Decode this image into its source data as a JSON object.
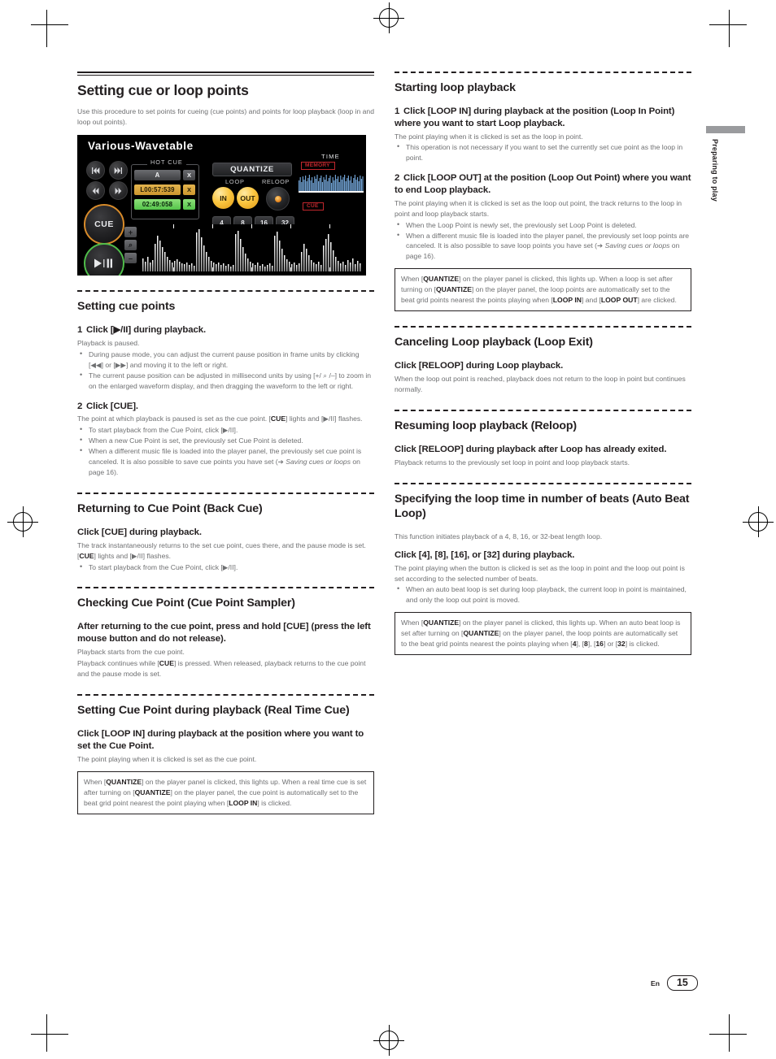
{
  "page": {
    "footer_lang": "En",
    "footer_page": "15",
    "side_tab_label": "Preparing to play"
  },
  "left_column": {
    "title": "Setting cue or loop points",
    "intro": "Use this procedure to set points for cueing (cue points) and points for loop playback (loop in and loop out points).",
    "player_panel": {
      "track_title": "Various-Wavetable",
      "hot_cue_label": "HOT CUE",
      "hot_cue_rows": [
        {
          "value": "A",
          "close": "X",
          "color": "grey"
        },
        {
          "value": "L00:57:539",
          "close": "X",
          "color": "orange"
        },
        {
          "value": "02:49:058",
          "close": "X",
          "color": "green"
        }
      ],
      "quantize_label": "QUANTIZE",
      "loop_label": "LOOP",
      "reloop_label": "RELOOP",
      "loop_in_label": "IN",
      "loop_out_label": "OUT",
      "beat_buttons": [
        "4",
        "8",
        "16",
        "32"
      ],
      "time_label": "TIME",
      "memory_tag": "MEMORY",
      "cue_tag": "CUE",
      "cue_button_label": "CUE",
      "play_pause_label": "▶/II",
      "transport_buttons": [
        "⏮",
        "⏭",
        "◀◀",
        "▶▶"
      ],
      "zoom_controls": [
        "+",
        "⌕",
        "–"
      ]
    },
    "sections": [
      {
        "heading": "Setting cue points",
        "steps": [
          {
            "num": "1",
            "title": "Click [▶/II] during playback.",
            "body": "Playback is paused.",
            "bullets": [
              "During pause mode, you can adjust the current pause position in frame units by clicking [◀◀] or [▶▶] and moving it to the left or right.",
              "The current pause position can be adjusted in millisecond units by using [+/ ⌕ /–] to zoom in on the enlarged waveform display, and then dragging the waveform to the left or right."
            ]
          },
          {
            "num": "2",
            "title": "Click [CUE].",
            "body": "The point at which playback is paused is set as the cue point. [CUE] lights and [▶/II] flashes.",
            "bullets": [
              "To start playback from the Cue Point, click [▶/II].",
              "When a new Cue Point is set, the previously set Cue Point is deleted.",
              "When a different music file is loaded into the player panel, the previously set cue point is canceled. It is also possible to save cue points you have set (➔ Saving cues or loops on page 16)."
            ]
          }
        ]
      },
      {
        "heading": "Returning to Cue Point (Back Cue)",
        "bold_lead": "Click [CUE] during playback.",
        "body": "The track instantaneously returns to the set cue point, cues there, and the pause mode is set. [CUE] lights and [▶/II] flashes.",
        "bullets": [
          "To start playback from the Cue Point, click [▶/II]."
        ]
      },
      {
        "heading": "Checking Cue Point (Cue Point Sampler)",
        "bold_lead": "After returning to the cue point, press and hold [CUE] (press the left mouse button and do not release).",
        "body": "Playback starts from the cue point.",
        "body2": "Playback continues while [CUE] is pressed. When released, playback returns to the cue point and the pause mode is set."
      },
      {
        "heading": "Setting Cue Point during playback (Real Time Cue)",
        "bold_lead": "Click [LOOP IN] during playback at the position where you want to set the Cue Point.",
        "body": "The point playing when it is clicked is set as the cue point.",
        "note": "When [QUANTIZE] on the player panel is clicked, this lights up. When a real time cue is set after turning on [QUANTIZE] on the player panel, the cue point is automatically set to the beat grid point nearest the point playing when [LOOP IN] is clicked."
      }
    ]
  },
  "right_column": {
    "sections": [
      {
        "heading": "Starting loop playback",
        "steps": [
          {
            "num": "1",
            "title": "Click [LOOP IN] during playback at the position (Loop In Point) where you want to start Loop playback.",
            "body": "The point playing when it is clicked is set as the loop in point.",
            "bullets": [
              "This operation is not necessary if you want to set the currently set cue point as the loop in point."
            ]
          },
          {
            "num": "2",
            "title": "Click [LOOP OUT] at the position (Loop Out Point) where you want to end Loop playback.",
            "body": "The point playing when it is clicked is set as the loop out point, the track returns to the loop in point and loop playback starts.",
            "bullets": [
              "When the Loop Point is newly set, the previously set Loop Point is deleted.",
              "When a different music file is loaded into the player panel, the previously set loop points are canceled. It is also possible to save loop points you have set (➔ Saving cues or loops on page 16)."
            ],
            "note": "When [QUANTIZE] on the player panel is clicked, this lights up. When a loop is set after turning on [QUANTIZE] on the player panel, the loop points are automatically set to the beat grid points nearest the points playing when [LOOP IN] and [LOOP OUT] are clicked."
          }
        ]
      },
      {
        "heading": "Canceling Loop playback (Loop Exit)",
        "bold_lead": "Click [RELOOP] during Loop playback.",
        "body": "When the loop out point is reached, playback does not return to the loop in point but continues normally."
      },
      {
        "heading": "Resuming loop playback (Reloop)",
        "bold_lead": "Click [RELOOP] during playback after Loop has already exited.",
        "body": "Playback returns to the previously set loop in point and loop playback starts."
      },
      {
        "heading": "Specifying the loop time in number of beats (Auto Beat Loop)",
        "intro": "This function initiates playback of a 4, 8, 16, or 32-beat length loop.",
        "bold_lead": "Click [4], [8], [16], or [32] during playback.",
        "body": "The point playing when the button is clicked is set as the loop in point and the loop out point is set according to the selected number of beats.",
        "bullets": [
          "When an auto beat loop is set during loop playback, the current loop in point is maintained, and only the loop out point is moved."
        ],
        "note": "When [QUANTIZE] on the player panel is clicked, this lights up. When an auto beat loop is set after turning on [QUANTIZE] on the player panel, the loop points are automatically set to the beat grid points nearest the points playing when [4], [8], [16] or [32] is clicked."
      }
    ]
  }
}
